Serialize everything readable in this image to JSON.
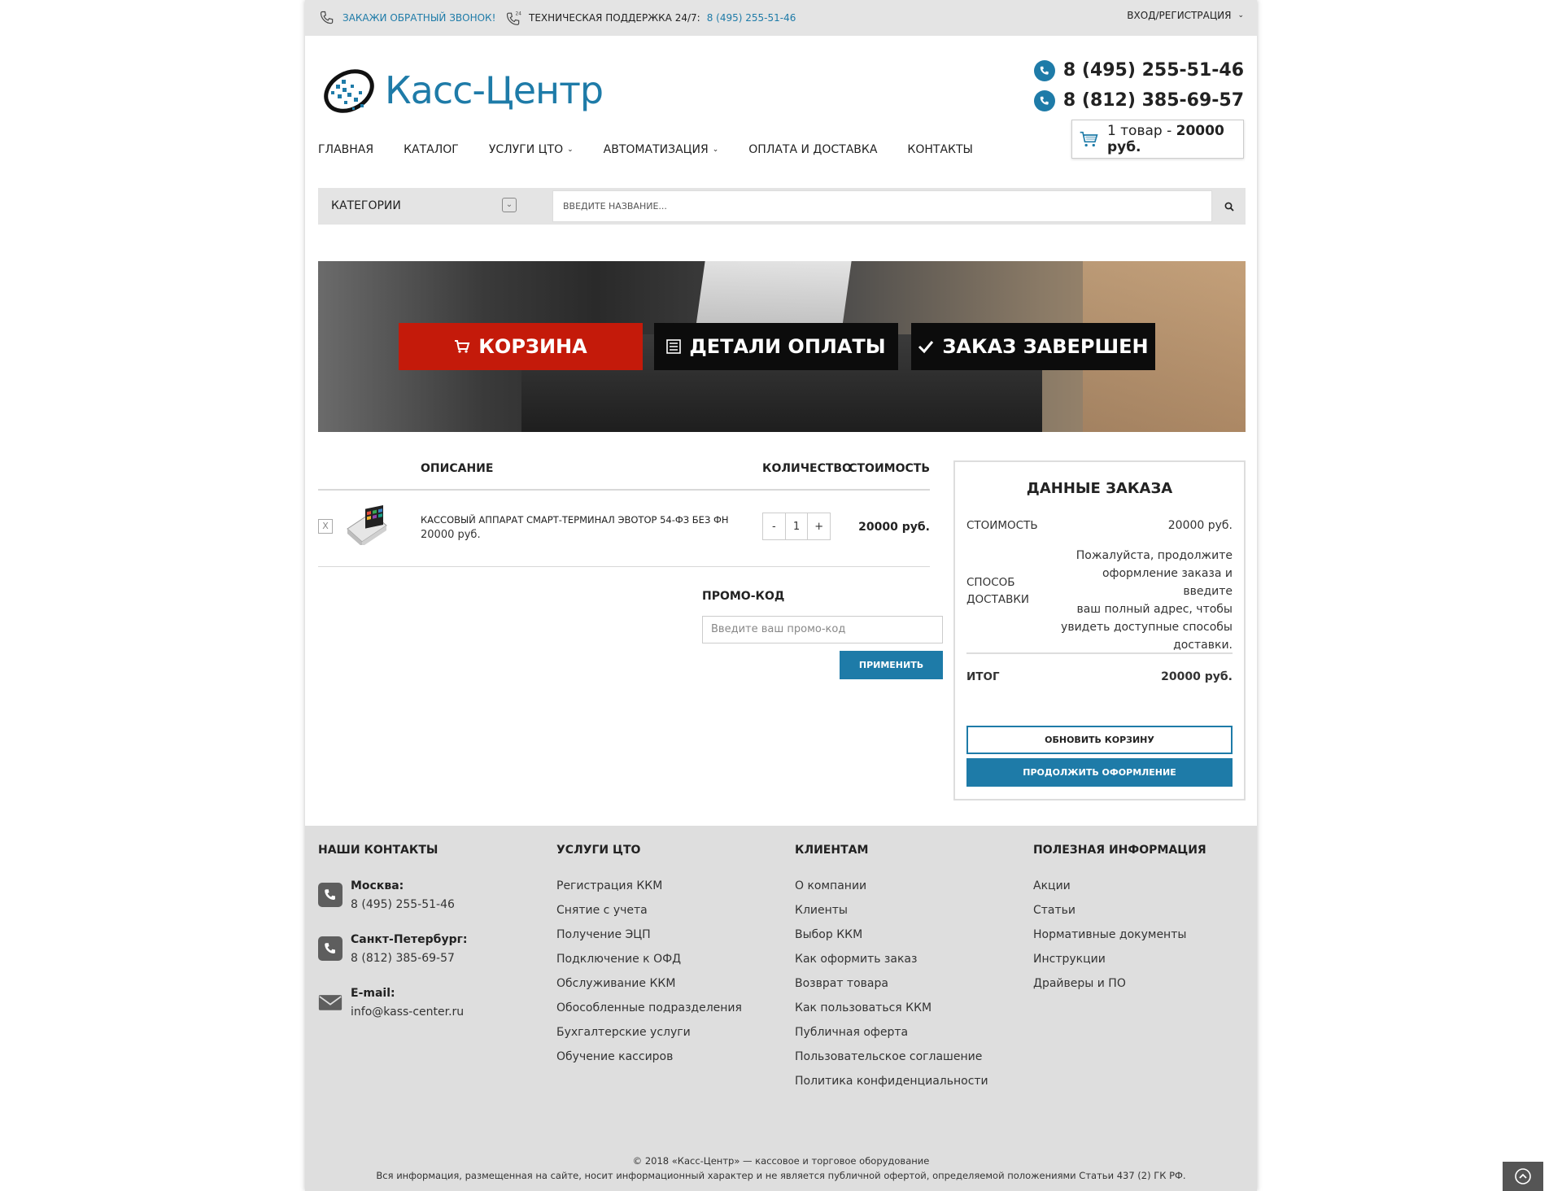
{
  "topbar": {
    "callback": "Закажи обратный звонок!",
    "support_label": "Техническая поддержка 24/7:",
    "support_phone": "8 (495) 255-51-46",
    "login": "Вход/Регистрация"
  },
  "logo": {
    "text": "Касс-Центр"
  },
  "phones": [
    "8 (495) 255-51-46",
    "8 (812) 385-69-57"
  ],
  "cart": {
    "count": "1 товар - ",
    "total": "20000 руб."
  },
  "nav": [
    "Главная",
    "Каталог",
    "Услуги ЦТО",
    "Автоматизация",
    "Оплата и доставка",
    "Контакты"
  ],
  "search": {
    "categories": "Категории",
    "placeholder": "Введите название..."
  },
  "steps": [
    "Корзина",
    "Детали оплаты",
    "Заказ завершен"
  ],
  "table": {
    "col_desc": "Описание",
    "col_qty": "Количество",
    "col_cost": "Стоимость",
    "remove": "X",
    "product_name": "Кассовый аппарат Смарт-терминал Эвотор 54-ФЗ без ФН",
    "product_price": "20000 руб.",
    "qty_minus": "-",
    "qty": "1",
    "qty_plus": "+",
    "product_total": "20000 руб."
  },
  "promo": {
    "label": "Промо-код",
    "placeholder": "Введите ваш промо-код",
    "apply": "Применить"
  },
  "order": {
    "title": "Данные заказа",
    "cost_label": "Стоимость",
    "cost_value": "20000 руб.",
    "delivery_label_1": "Способ",
    "delivery_label_2": "доставки",
    "delivery_note_1": "Пожалуйста, продолжите",
    "delivery_note_2": "оформление заказа и введите",
    "delivery_note_3": "ваш полный адрес, чтобы",
    "delivery_note_4": "увидеть доступные способы",
    "delivery_note_5": "доставки.",
    "total_label": "Итог",
    "total_value": "20000 руб.",
    "update": "Обновить корзину",
    "checkout": "Продолжить оформление"
  },
  "footer": {
    "contacts_title": "Наши контакты",
    "moscow_label": "Москва:",
    "moscow_phone": "8 (495) 255-51-46",
    "spb_label": "Санкт-Петербург:",
    "spb_phone": "8 (812) 385-69-57",
    "email_label": "E-mail:",
    "email": "info@kass-center.ru",
    "services_title": "Услуги ЦТО",
    "services": [
      "Регистрация ККМ",
      "Снятие с учета",
      "Получение ЭЦП",
      "Подключение к ОФД",
      "Обслуживание ККМ",
      "Обособленные подразделения",
      "Бухгалтерские услуги",
      "Обучение кассиров"
    ],
    "clients_title": "Клиентам",
    "clients": [
      "О компании",
      "Клиенты",
      "Выбор ККМ",
      "Как оформить заказ",
      "Возврат товара",
      "Как пользоваться ККМ",
      "Публичная оферта",
      "Пользовательское соглашение",
      "Политика конфиденциальности"
    ],
    "info_title": "Полезная информация",
    "info": [
      "Акции",
      "Статьи",
      "Нормативные документы",
      "Инструкции",
      "Драйверы и ПО"
    ],
    "copyright_1": "© 2018 «Касс-Центр» — кассовое и торговое оборудование",
    "copyright_2": "Вся информация, размещенная на сайте, носит информационный характер и не является публичной офертой, определяемой положениями Статьи 437 (2) ГК РФ."
  },
  "colors": {
    "accent": "#1e7ba8",
    "step_active": "#c41a0a",
    "step_inactive": "#0c0c0c",
    "footer_bg": "#dedede"
  }
}
